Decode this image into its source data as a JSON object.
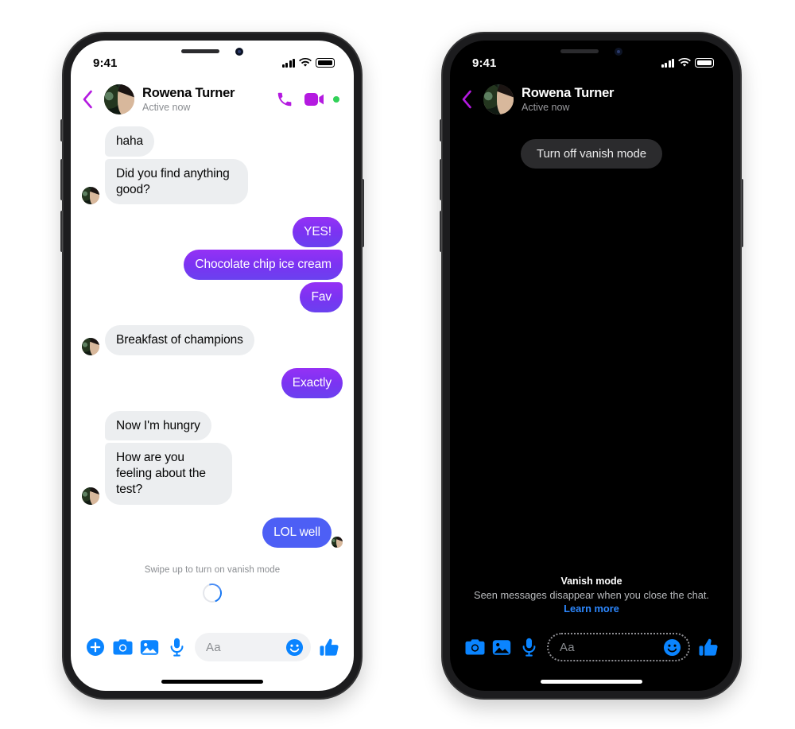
{
  "colors": {
    "messenger_blue": "#0a84ff",
    "bubble_blue": "#4d5ff5",
    "bubble_purple_top": "#9531f5",
    "bubble_purple_bottom": "#6a41ef",
    "bubble_gray": "#eceef0",
    "vanish_purple": "#b41ae0",
    "online_green": "#31d158",
    "link_blue": "#2d88ff",
    "dark_pill": "#2b2b2d"
  },
  "phones": [
    {
      "mode": "light",
      "status_bar": {
        "time": "9:41",
        "signal_icon": "cellular-bars-icon",
        "wifi_icon": "wifi-icon",
        "battery_icon": "battery-icon"
      },
      "header": {
        "back_icon": "back-chevron-icon",
        "avatar": "contact-avatar",
        "name": "Rowena Turner",
        "presence": "Active now",
        "call_icon": "phone-call-icon",
        "video_icon": "video-call-icon",
        "online_dot": "online-status-dot"
      },
      "messages": [
        {
          "side": "in",
          "text": "haha",
          "group": "top",
          "avatar": false
        },
        {
          "side": "in",
          "text": "Did you find anything good?",
          "group": "bot",
          "avatar": true
        },
        {
          "side": "out",
          "text": "YES!",
          "style": "purple",
          "group": "top"
        },
        {
          "side": "out",
          "text": "Chocolate chip ice cream",
          "style": "purple",
          "group": "mid"
        },
        {
          "side": "out",
          "text": "Fav",
          "style": "purple",
          "group": "bot"
        },
        {
          "side": "in",
          "text": "Breakfast of champions",
          "group": "single",
          "avatar": true
        },
        {
          "side": "out",
          "text": "Exactly",
          "style": "purple",
          "group": "single"
        },
        {
          "side": "in",
          "text": "Now I'm hungry",
          "group": "top",
          "avatar": false
        },
        {
          "side": "in",
          "text": "How are you feeling about the test?",
          "group": "bot",
          "avatar": true
        },
        {
          "side": "out",
          "text": "LOL well",
          "style": "blue",
          "group": "single",
          "receipt": true
        }
      ],
      "swipe_hint": "Swipe up to turn on vanish mode",
      "spinner": "loading-spinner",
      "composer": {
        "actions": [
          "plus-icon",
          "camera-icon",
          "photo-gallery-icon",
          "microphone-icon"
        ],
        "placeholder": "Aa",
        "emoji_icon": "emoji-smiley-icon",
        "like_icon": "thumbs-up-icon"
      },
      "home_indicator": "home-indicator"
    },
    {
      "mode": "dark",
      "status_bar": {
        "time": "9:41",
        "signal_icon": "cellular-bars-icon",
        "wifi_icon": "wifi-icon",
        "battery_icon": "battery-icon"
      },
      "header": {
        "back_icon": "back-chevron-icon",
        "avatar": "contact-avatar",
        "name": "Rowena Turner",
        "presence": "Active now"
      },
      "vanish_pill": "Turn off vanish mode",
      "footer": {
        "title": "Vanish mode",
        "subtitle": "Seen messages disappear when you close the chat.",
        "link": "Learn more"
      },
      "composer": {
        "actions": [
          "camera-icon",
          "photo-gallery-icon",
          "microphone-icon"
        ],
        "placeholder": "Aa",
        "emoji_icon": "emoji-smiley-icon",
        "like_icon": "thumbs-up-icon"
      },
      "home_indicator": "home-indicator"
    }
  ]
}
